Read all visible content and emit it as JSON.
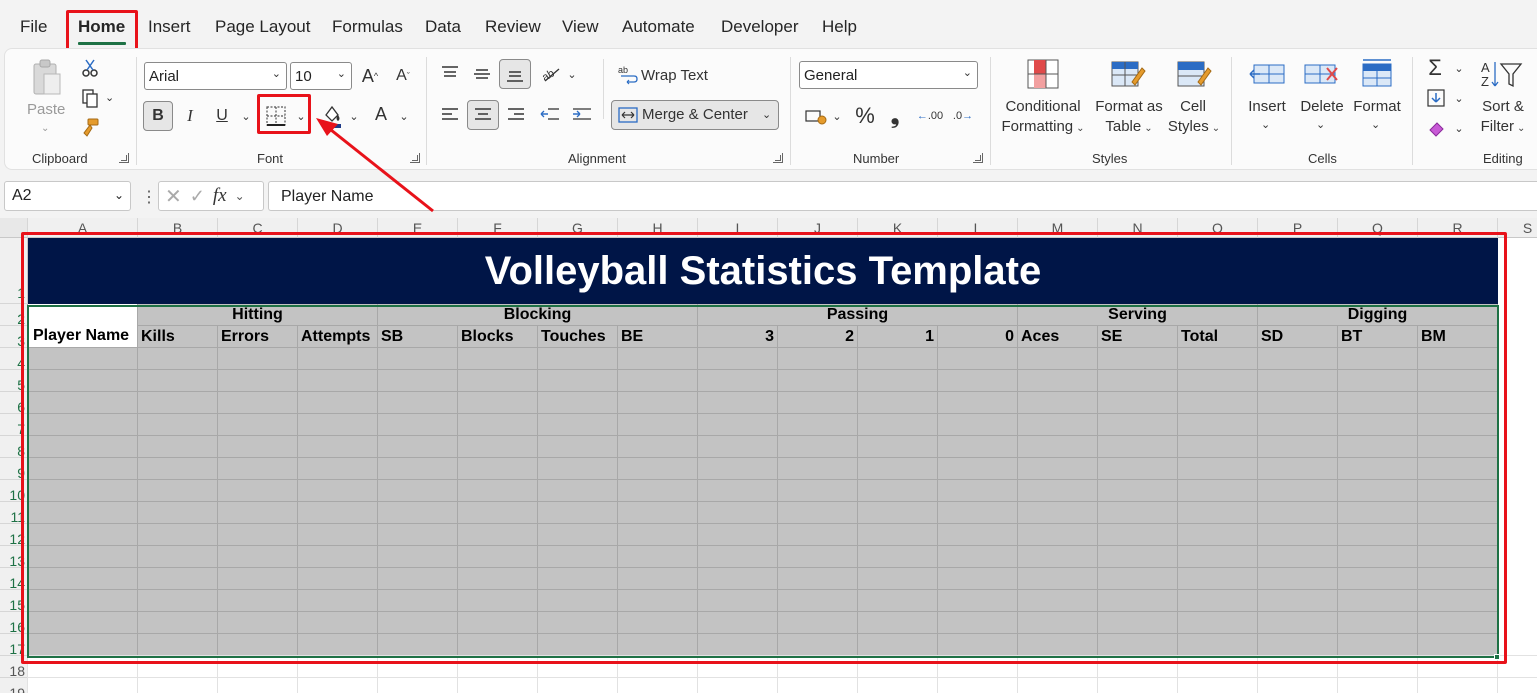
{
  "menu": {
    "tabs": [
      "File",
      "Home",
      "Insert",
      "Page Layout",
      "Formulas",
      "Data",
      "Review",
      "View",
      "Automate",
      "Developer",
      "Help"
    ]
  },
  "ribbon": {
    "clipboard": {
      "paste": "Paste",
      "label": "Clipboard"
    },
    "font": {
      "name": "Arial",
      "size": "10",
      "bold": "B",
      "italic": "I",
      "underline": "U",
      "label": "Font",
      "font_color": "A"
    },
    "alignment": {
      "wrap_text": "Wrap Text",
      "merge_center": "Merge & Center",
      "label": "Alignment"
    },
    "number": {
      "format": "General",
      "percent": "%",
      "comma": "❟",
      "label": "Number",
      "inc_decimal": ".00",
      "dec_decimal": ".0"
    },
    "styles": {
      "conditional_1": "Conditional",
      "conditional_2": "Formatting",
      "format_table_1": "Format as",
      "format_table_2": "Table",
      "cell_styles_1": "Cell",
      "cell_styles_2": "Styles",
      "label": "Styles"
    },
    "cells": {
      "insert": "Insert",
      "delete": "Delete",
      "format": "Format",
      "label": "Cells"
    },
    "editing": {
      "sort_1": "Sort &",
      "sort_2": "Filter",
      "label": "Editing"
    }
  },
  "formula_bar": {
    "name_box": "A2",
    "fx": "fx",
    "content": "Player Name"
  },
  "sheet": {
    "columns": [
      "A",
      "B",
      "C",
      "D",
      "E",
      "F",
      "G",
      "H",
      "I",
      "J",
      "K",
      "L",
      "M",
      "N",
      "O",
      "P",
      "Q",
      "R",
      "S"
    ],
    "rows": [
      "1",
      "2",
      "3",
      "4",
      "5",
      "6",
      "7",
      "8",
      "9",
      "10",
      "11",
      "12",
      "13",
      "14",
      "15",
      "16",
      "17",
      "18",
      "19"
    ],
    "title": "Volleyball Statistics Template",
    "groups": [
      "Hitting",
      "Blocking",
      "Passing",
      "Serving",
      "Digging"
    ],
    "headers": [
      "Player Name",
      "Kills",
      "Errors",
      "Attempts",
      "SB",
      "Blocks",
      "Touches",
      "BE",
      "3",
      "2",
      "1",
      "0",
      "Aces",
      "SE",
      "Total",
      "SD",
      "BT",
      "BM"
    ]
  },
  "colors": {
    "title_bg": "#001547",
    "selection": "#1e7145",
    "annotation": "#e8121a",
    "fill_gray": "#c3c3c3"
  }
}
